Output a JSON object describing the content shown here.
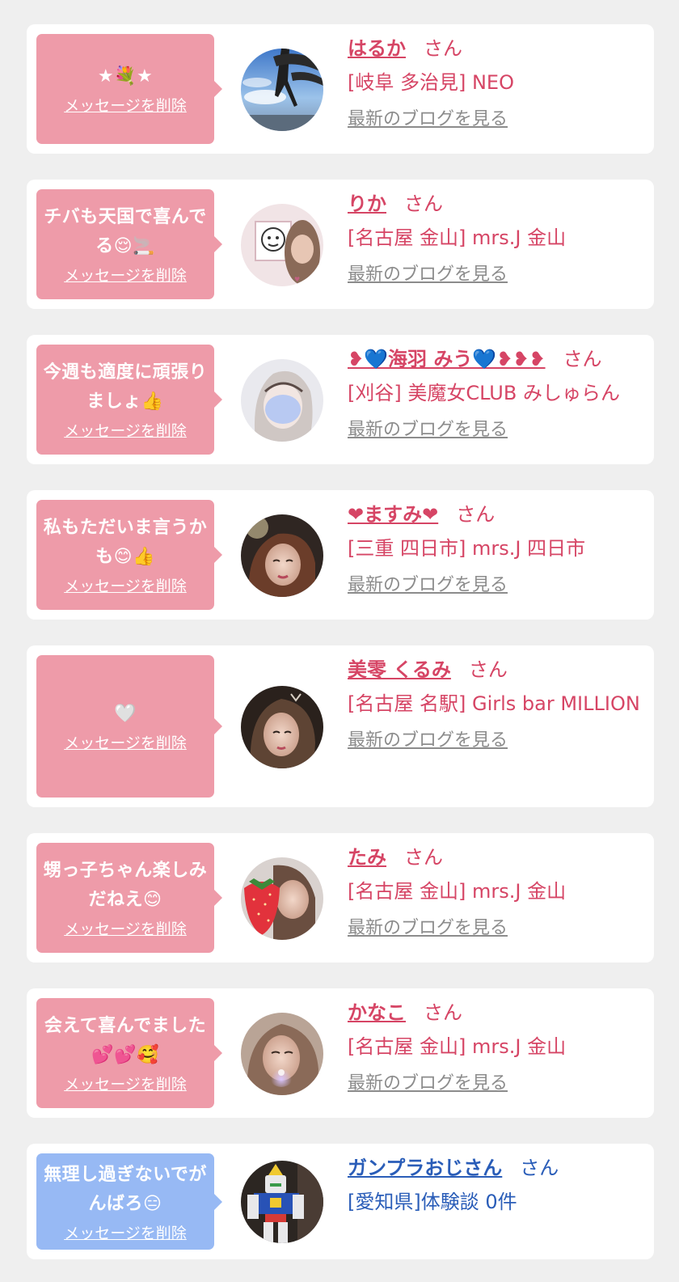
{
  "delete_label": "メッセージを削除",
  "san_label": "さん",
  "blog_label": "最新のブログを見る",
  "colors": {
    "background": "#efefef",
    "card": "#ffffff",
    "bubble_pink": "#ee9ba9",
    "bubble_blue": "#97b9f4",
    "name_pink": "#d64565",
    "name_blue": "#2a5db8",
    "blog_link": "#8c8c8c"
  },
  "entries": [
    {
      "message": "★💐★",
      "name": "はるか",
      "shop": "[岐阜 多治見] NEO",
      "has_blog": true,
      "theme": "pink",
      "avatar": "tree-sky"
    },
    {
      "message": "チバも天国で喜んでる😌🚬",
      "name": "りか",
      "shop": "[名古屋 金山] mrs.J 金山",
      "has_blog": true,
      "theme": "pink",
      "avatar": "sticker-face"
    },
    {
      "message": "今週も適度に頑張りましょ👍",
      "name": "❥💙海羽 みう💙❥❥❥",
      "shop": "[刈谷] 美魔女CLUB みしゅらん",
      "has_blog": true,
      "theme": "pink",
      "avatar": "blur-girl"
    },
    {
      "message": "私もただいま言うかも😊👍",
      "name": "❤ますみ❤",
      "shop": "[三重 四日市] mrs.J 四日市",
      "has_blog": true,
      "theme": "pink",
      "avatar": "warm-portrait"
    },
    {
      "message": "🤍",
      "name": "美零 くるみ",
      "shop": "[名古屋 名駅] Girls bar MILLION",
      "has_blog": true,
      "theme": "pink",
      "avatar": "dark-portrait"
    },
    {
      "message": "甥っ子ちゃん楽しみだねえ😊",
      "name": "たみ",
      "shop": "[名古屋 金山] mrs.J 金山",
      "has_blog": true,
      "theme": "pink",
      "avatar": "strawberry"
    },
    {
      "message": "会えて喜んでました💕💕🥰",
      "name": "かなこ",
      "shop": "[名古屋 金山] mrs.J 金山",
      "has_blog": true,
      "theme": "pink",
      "avatar": "sparkle-portrait"
    },
    {
      "message": "無理し過ぎないでがんばろ😑",
      "name": "ガンプラおじさん",
      "shop": "[愛知県]体験談 0件",
      "has_blog": false,
      "theme": "blue",
      "avatar": "robot-model"
    }
  ]
}
